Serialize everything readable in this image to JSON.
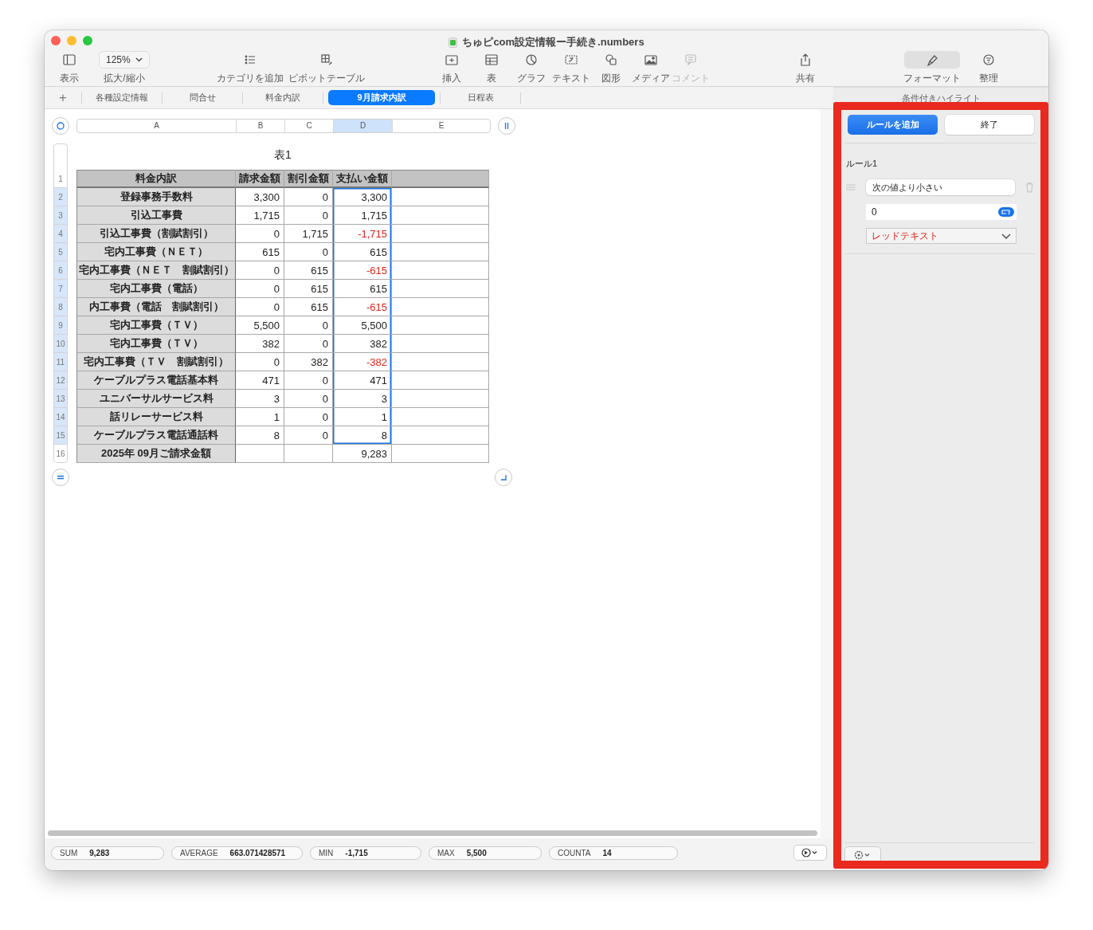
{
  "window": {
    "title": "ちゅピcom設定情報ー手続き.numbers"
  },
  "toolbar": {
    "groups": [
      [
        {
          "kind": "sidebar",
          "label": "表示",
          "disabled": false,
          "selected": false
        },
        {
          "kind": "zoom",
          "label": "拡大/縮小",
          "value": "125%",
          "disabled": false,
          "selected": false
        }
      ],
      [
        {
          "kind": "list",
          "label": "カテゴリを追加",
          "disabled": false,
          "selected": false
        },
        {
          "kind": "pivot",
          "label": "ピボットテーブル",
          "disabled": false,
          "selected": false
        }
      ],
      [
        {
          "kind": "insert",
          "label": "挿入",
          "disabled": false,
          "selected": false
        },
        {
          "kind": "table",
          "label": "表",
          "disabled": false,
          "selected": false
        },
        {
          "kind": "chart",
          "label": "グラフ",
          "disabled": false,
          "selected": false
        },
        {
          "kind": "text",
          "label": "テキスト",
          "disabled": false,
          "selected": false
        },
        {
          "kind": "shape",
          "label": "図形",
          "disabled": false,
          "selected": false
        },
        {
          "kind": "media",
          "label": "メディア",
          "disabled": false,
          "selected": false
        },
        {
          "kind": "comment",
          "label": "コメント",
          "disabled": true,
          "selected": false
        }
      ],
      [
        {
          "kind": "share",
          "label": "共有",
          "disabled": false,
          "selected": false
        }
      ],
      [
        {
          "kind": "format",
          "label": "フォーマット",
          "disabled": false,
          "selected": true
        },
        {
          "kind": "organize",
          "label": "整理",
          "disabled": false,
          "selected": false
        }
      ]
    ]
  },
  "add_sheet": "+",
  "sheets": [
    {
      "label": "各種設定情報",
      "selected": false
    },
    {
      "label": "問合せ",
      "selected": false
    },
    {
      "label": "料金内訳",
      "selected": false
    },
    {
      "label": "9月請求内訳",
      "selected": true
    },
    {
      "label": "日程表",
      "selected": false
    }
  ],
  "table": {
    "title": "表1",
    "columns": [
      {
        "label": "A",
        "selected": false
      },
      {
        "label": "B",
        "selected": false
      },
      {
        "label": "C",
        "selected": false
      },
      {
        "label": "D",
        "selected": true
      },
      {
        "label": "E",
        "selected": false
      }
    ],
    "rows": [
      {
        "number": "1",
        "kind": "header",
        "selected": false,
        "cells": [
          {
            "text": "料金内訳",
            "negative": false
          },
          {
            "text": "請求金額",
            "negative": false
          },
          {
            "text": "割引金額",
            "negative": false
          },
          {
            "text": "支払い金額",
            "negative": false
          }
        ]
      },
      {
        "number": "2",
        "kind": "data",
        "selected": true,
        "cells": [
          {
            "text": "登録事務手数料",
            "negative": false
          },
          {
            "text": "3,300",
            "negative": false
          },
          {
            "text": "0",
            "negative": false
          },
          {
            "text": "3,300",
            "negative": false
          }
        ]
      },
      {
        "number": "3",
        "kind": "data",
        "selected": true,
        "cells": [
          {
            "text": "引込工事費",
            "negative": false
          },
          {
            "text": "1,715",
            "negative": false
          },
          {
            "text": "0",
            "negative": false
          },
          {
            "text": "1,715",
            "negative": false
          }
        ]
      },
      {
        "number": "4",
        "kind": "data",
        "selected": true,
        "cells": [
          {
            "text": "引込工事費（割賦割引）",
            "negative": false
          },
          {
            "text": "0",
            "negative": false
          },
          {
            "text": "1,715",
            "negative": false
          },
          {
            "text": "-1,715",
            "negative": true
          }
        ]
      },
      {
        "number": "5",
        "kind": "data",
        "selected": true,
        "cells": [
          {
            "text": "宅内工事費（ＮＥＴ）",
            "negative": false
          },
          {
            "text": "615",
            "negative": false
          },
          {
            "text": "0",
            "negative": false
          },
          {
            "text": "615",
            "negative": false
          }
        ]
      },
      {
        "number": "6",
        "kind": "data",
        "selected": true,
        "cells": [
          {
            "text": "宅内工事費（ＮＥＴ　割賦割引）",
            "negative": false
          },
          {
            "text": "0",
            "negative": false
          },
          {
            "text": "615",
            "negative": false
          },
          {
            "text": "-615",
            "negative": true
          }
        ]
      },
      {
        "number": "7",
        "kind": "data",
        "selected": true,
        "cells": [
          {
            "text": "宅内工事費（電話）",
            "negative": false
          },
          {
            "text": "0",
            "negative": false
          },
          {
            "text": "615",
            "negative": false
          },
          {
            "text": "615",
            "negative": false
          }
        ]
      },
      {
        "number": "8",
        "kind": "data",
        "selected": true,
        "cells": [
          {
            "text": "内工事費（電話　割賦割引）",
            "negative": false
          },
          {
            "text": "0",
            "negative": false
          },
          {
            "text": "615",
            "negative": false
          },
          {
            "text": "-615",
            "negative": true
          }
        ]
      },
      {
        "number": "9",
        "kind": "data",
        "selected": true,
        "cells": [
          {
            "text": "宅内工事費（ＴＶ）",
            "negative": false
          },
          {
            "text": "5,500",
            "negative": false
          },
          {
            "text": "0",
            "negative": false
          },
          {
            "text": "5,500",
            "negative": false
          }
        ]
      },
      {
        "number": "10",
        "kind": "data",
        "selected": true,
        "cells": [
          {
            "text": "宅内工事費（ＴＶ）",
            "negative": false
          },
          {
            "text": "382",
            "negative": false
          },
          {
            "text": "0",
            "negative": false
          },
          {
            "text": "382",
            "negative": false
          }
        ]
      },
      {
        "number": "11",
        "kind": "data",
        "selected": true,
        "cells": [
          {
            "text": "宅内工事費（ＴＶ　割賦割引）",
            "negative": false
          },
          {
            "text": "0",
            "negative": false
          },
          {
            "text": "382",
            "negative": false
          },
          {
            "text": "-382",
            "negative": true
          }
        ]
      },
      {
        "number": "12",
        "kind": "data",
        "selected": true,
        "cells": [
          {
            "text": "ケーブルプラス電話基本料",
            "negative": false
          },
          {
            "text": "471",
            "negative": false
          },
          {
            "text": "0",
            "negative": false
          },
          {
            "text": "471",
            "negative": false
          }
        ]
      },
      {
        "number": "13",
        "kind": "data",
        "selected": true,
        "cells": [
          {
            "text": "ユニバーサルサービス料",
            "negative": false
          },
          {
            "text": "3",
            "negative": false
          },
          {
            "text": "0",
            "negative": false
          },
          {
            "text": "3",
            "negative": false
          }
        ]
      },
      {
        "number": "14",
        "kind": "data",
        "selected": true,
        "cells": [
          {
            "text": "話リレーサービス料",
            "negative": false
          },
          {
            "text": "1",
            "negative": false
          },
          {
            "text": "0",
            "negative": false
          },
          {
            "text": "1",
            "negative": false
          }
        ]
      },
      {
        "number": "15",
        "kind": "data",
        "selected": true,
        "cells": [
          {
            "text": "ケーブルプラス電話通話料",
            "negative": false
          },
          {
            "text": "8",
            "negative": false
          },
          {
            "text": "0",
            "negative": false
          },
          {
            "text": "8",
            "negative": false
          }
        ]
      },
      {
        "number": "16",
        "kind": "data",
        "selected": false,
        "cells": [
          {
            "text": "2025年 09月ご請求金額",
            "negative": false
          },
          null,
          null,
          {
            "text": "9,283",
            "negative": false
          }
        ]
      }
    ]
  },
  "status_bar": [
    {
      "label": "SUM",
      "value": "9,283"
    },
    {
      "label": "AVERAGE",
      "value": "663.071428571"
    },
    {
      "label": "MIN",
      "value": "-1,715"
    },
    {
      "label": "MAX",
      "value": "5,500"
    },
    {
      "label": "COUNTA",
      "value": "14"
    }
  ],
  "sidebar": {
    "title": "条件付きハイライト",
    "buttons": [
      {
        "label": "ルールを追加",
        "kind": "primary"
      },
      {
        "label": "終了",
        "kind": "default"
      }
    ],
    "rules": [
      {
        "title": "ルール1",
        "condition": "次の値より小さい",
        "value": "0",
        "style": "レッドテキスト"
      }
    ]
  }
}
